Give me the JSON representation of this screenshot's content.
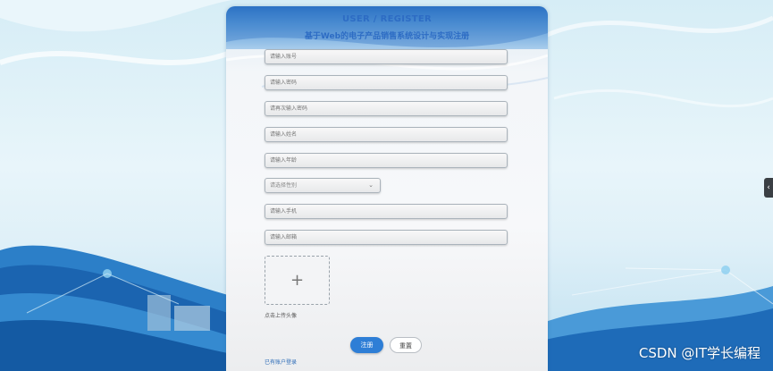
{
  "page": {
    "title_en": "USER / REGISTER",
    "title_cn": "基于Web的电子产品销售系统设计与实现注册"
  },
  "form": {
    "account_placeholder": "请输入账号",
    "password_placeholder": "请输入密码",
    "confirm_password_placeholder": "请再次输入密码",
    "name_placeholder": "请输入姓名",
    "age_placeholder": "请输入年龄",
    "gender_placeholder": "请选择性别",
    "phone_placeholder": "请输入手机",
    "email_placeholder": "请输入邮箱",
    "upload_label": "点击上传头像",
    "upload_icon": "plus-icon"
  },
  "actions": {
    "register_label": "注册",
    "reset_label": "重置",
    "login_link": "已有账户登录"
  },
  "side_tab": {
    "icon": "chevron-left-icon",
    "glyph": "‹"
  },
  "watermark": "CSDN @IT学长编程",
  "colors": {
    "accent": "#2e7ed6",
    "title": "#2d6cc4"
  }
}
